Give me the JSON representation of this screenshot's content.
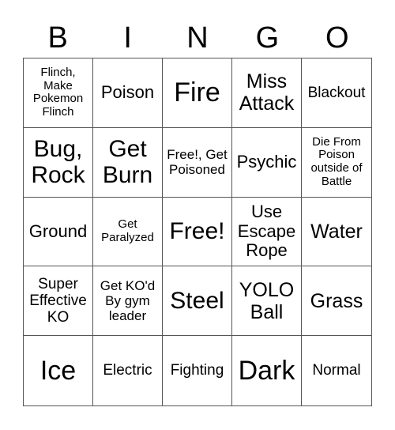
{
  "header": {
    "letters": [
      "B",
      "I",
      "N",
      "G",
      "O"
    ]
  },
  "cells": [
    [
      "Flinch, Make Pokemon Flinch",
      "Poison",
      "Fire",
      "Miss Attack",
      "Blackout"
    ],
    [
      "Bug, Rock",
      "Get Burn",
      "Free!, Get Poisoned",
      "Psychic",
      "Die From Poison outside of Battle"
    ],
    [
      "Ground",
      "Get Paralyzed",
      "Free!",
      "Use Escape Rope",
      "Water"
    ],
    [
      "Super Effective KO",
      "Get KO'd By gym leader",
      "Steel",
      "YOLO Ball",
      "Grass"
    ],
    [
      "Ice",
      "Electric",
      "Fighting",
      "Dark",
      "Normal"
    ]
  ]
}
